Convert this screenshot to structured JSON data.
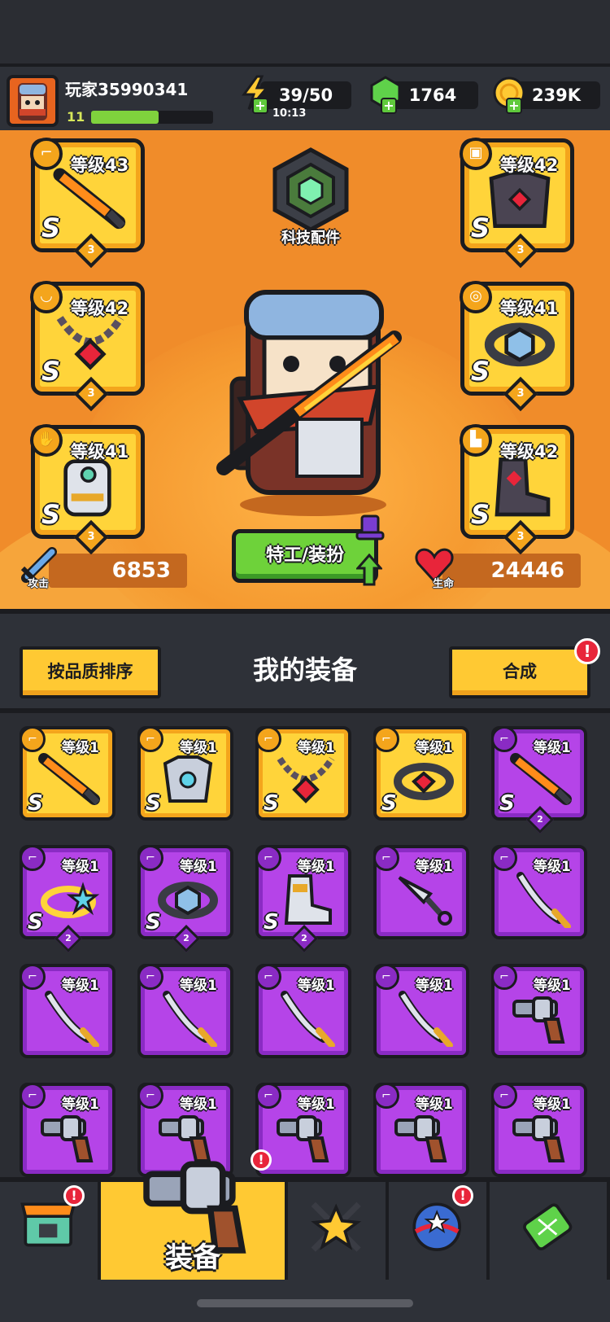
{
  "player": {
    "name": "玩家35990341",
    "level": "11",
    "xp_fraction": 0.55
  },
  "resources": {
    "energy": "39/50",
    "energy_timer": "10:13",
    "gems": "1764",
    "coins": "239K"
  },
  "equipped_left": [
    {
      "level": "等级43",
      "rank": "S",
      "stars": "3",
      "slot_icon": "gun-slot-icon",
      "item_icon": "flame-sword-icon"
    },
    {
      "level": "等级42",
      "rank": "S",
      "stars": "3",
      "slot_icon": "necklace-slot-icon",
      "item_icon": "chain-necklace-icon"
    },
    {
      "level": "等级41",
      "rank": "S",
      "stars": "3",
      "slot_icon": "glove-slot-icon",
      "item_icon": "mech-gauntlet-icon"
    }
  ],
  "equipped_right": [
    {
      "level": "等级42",
      "rank": "S",
      "stars": "3",
      "slot_icon": "armor-slot-icon",
      "item_icon": "dark-armor-icon"
    },
    {
      "level": "等级41",
      "rank": "S",
      "stars": "3",
      "slot_icon": "belt-slot-icon",
      "item_icon": "hex-belt-icon"
    },
    {
      "level": "等级42",
      "rank": "S",
      "stars": "3",
      "slot_icon": "boot-slot-icon",
      "item_icon": "dark-boot-icon"
    }
  ],
  "tech_label": "科技配件",
  "attack": {
    "label": "攻击",
    "value": "6853"
  },
  "hp": {
    "label": "生命",
    "value": "24446"
  },
  "agent_button": "特工/装扮",
  "sort_button": "按品质排序",
  "section_title": "我的装备",
  "merge_button": "合成",
  "badge_mark": "!",
  "inventory": [
    {
      "tier": "gold",
      "level": "等级1",
      "rank": "S",
      "stars": "",
      "item_icon": "flame-sword-icon"
    },
    {
      "tier": "gold",
      "level": "等级1",
      "rank": "S",
      "stars": "",
      "item_icon": "mech-armor-icon"
    },
    {
      "tier": "gold",
      "level": "等级1",
      "rank": "S",
      "stars": "",
      "item_icon": "chain-necklace-icon"
    },
    {
      "tier": "gold",
      "level": "等级1",
      "rank": "S",
      "stars": "",
      "item_icon": "belt-icon"
    },
    {
      "tier": "purple",
      "level": "等级1",
      "rank": "S",
      "stars": "2",
      "item_icon": "flame-sword-icon"
    },
    {
      "tier": "purple",
      "level": "等级1",
      "rank": "S",
      "stars": "2",
      "item_icon": "star-ring-icon"
    },
    {
      "tier": "purple",
      "level": "等级1",
      "rank": "S",
      "stars": "2",
      "item_icon": "hex-belt-icon"
    },
    {
      "tier": "purple",
      "level": "等级1",
      "rank": "S",
      "stars": "2",
      "item_icon": "mech-boot-icon"
    },
    {
      "tier": "purple",
      "level": "等级1",
      "rank": "",
      "stars": "",
      "item_icon": "kunai-icon"
    },
    {
      "tier": "purple",
      "level": "等级1",
      "rank": "",
      "stars": "",
      "item_icon": "katana-icon"
    },
    {
      "tier": "purple",
      "level": "等级1",
      "rank": "",
      "stars": "",
      "item_icon": "katana-icon"
    },
    {
      "tier": "purple",
      "level": "等级1",
      "rank": "",
      "stars": "",
      "item_icon": "katana-icon"
    },
    {
      "tier": "purple",
      "level": "等级1",
      "rank": "",
      "stars": "",
      "item_icon": "katana-icon"
    },
    {
      "tier": "purple",
      "level": "等级1",
      "rank": "",
      "stars": "",
      "item_icon": "katana-icon"
    },
    {
      "tier": "purple",
      "level": "等级1",
      "rank": "",
      "stars": "",
      "item_icon": "revolver-icon"
    },
    {
      "tier": "purple",
      "level": "等级1",
      "rank": "",
      "stars": "",
      "item_icon": "revolver-icon"
    },
    {
      "tier": "purple",
      "level": "等级1",
      "rank": "",
      "stars": "",
      "item_icon": "revolver-icon"
    },
    {
      "tier": "purple",
      "level": "等级1",
      "rank": "",
      "stars": "",
      "item_icon": "revolver-icon"
    },
    {
      "tier": "purple",
      "level": "等级1",
      "rank": "",
      "stars": "",
      "item_icon": "revolver-icon"
    },
    {
      "tier": "purple",
      "level": "等级1",
      "rank": "",
      "stars": "",
      "item_icon": "revolver-icon"
    }
  ],
  "nav": [
    {
      "label": "",
      "icon": "shop-icon",
      "badge": true,
      "active": false
    },
    {
      "label": "装备",
      "icon": "revolver-icon",
      "badge": true,
      "active": true
    },
    {
      "label": "",
      "icon": "crossed-swords-star-icon",
      "badge": false,
      "active": false
    },
    {
      "label": "",
      "icon": "planet-stars-icon",
      "badge": true,
      "active": false
    },
    {
      "label": "",
      "icon": "dna-capsule-icon",
      "badge": false,
      "active": false
    }
  ],
  "colors": {
    "gold_tier": "#ffd43a",
    "purple_tier": "#b544e8",
    "hero_bg": "#f08c2a",
    "panel_bg": "#2e3138",
    "accent_green": "#6ed23a",
    "alert_red": "#e8253a"
  }
}
